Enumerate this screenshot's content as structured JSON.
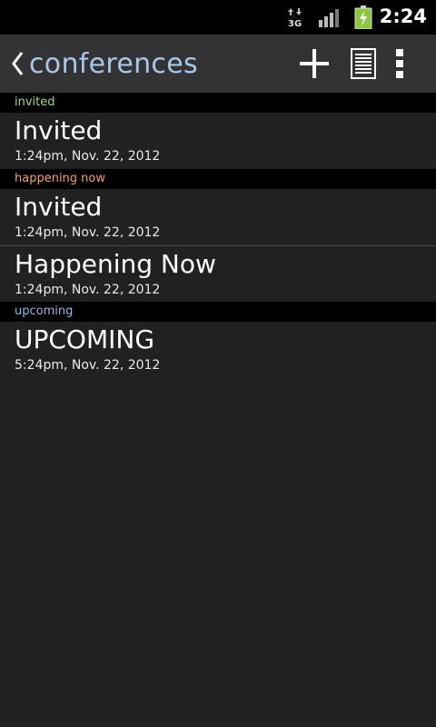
{
  "status_bar": {
    "time": "2:24",
    "network_label": "3G",
    "network_icon": "network-3g-icon",
    "signal_icon": "signal-icon",
    "battery_icon": "battery-charging-icon",
    "battery_color": "#8dc63f"
  },
  "action_bar": {
    "title": "conferences",
    "title_color": "#a9c8e7",
    "back_icon": "chevron-left-icon",
    "actions": [
      "add-icon",
      "list-icon",
      "overflow-icon"
    ]
  },
  "sections": [
    {
      "header": "invited",
      "header_color": "#a6d57e",
      "items": [
        {
          "title": "Invited",
          "subtitle": "1:24pm, Nov. 22, 2012"
        }
      ]
    },
    {
      "header": "happening now",
      "header_color": "#f1a166",
      "items": [
        {
          "title": "Invited",
          "subtitle": "1:24pm, Nov. 22, 2012"
        },
        {
          "title": "Happening Now",
          "subtitle": "1:24pm, Nov. 22, 2012"
        }
      ]
    },
    {
      "header": "upcoming",
      "header_color": "#8fb4e8",
      "items": [
        {
          "title": "UPCOMING",
          "subtitle": "5:24pm, Nov. 22, 2012"
        }
      ]
    }
  ]
}
